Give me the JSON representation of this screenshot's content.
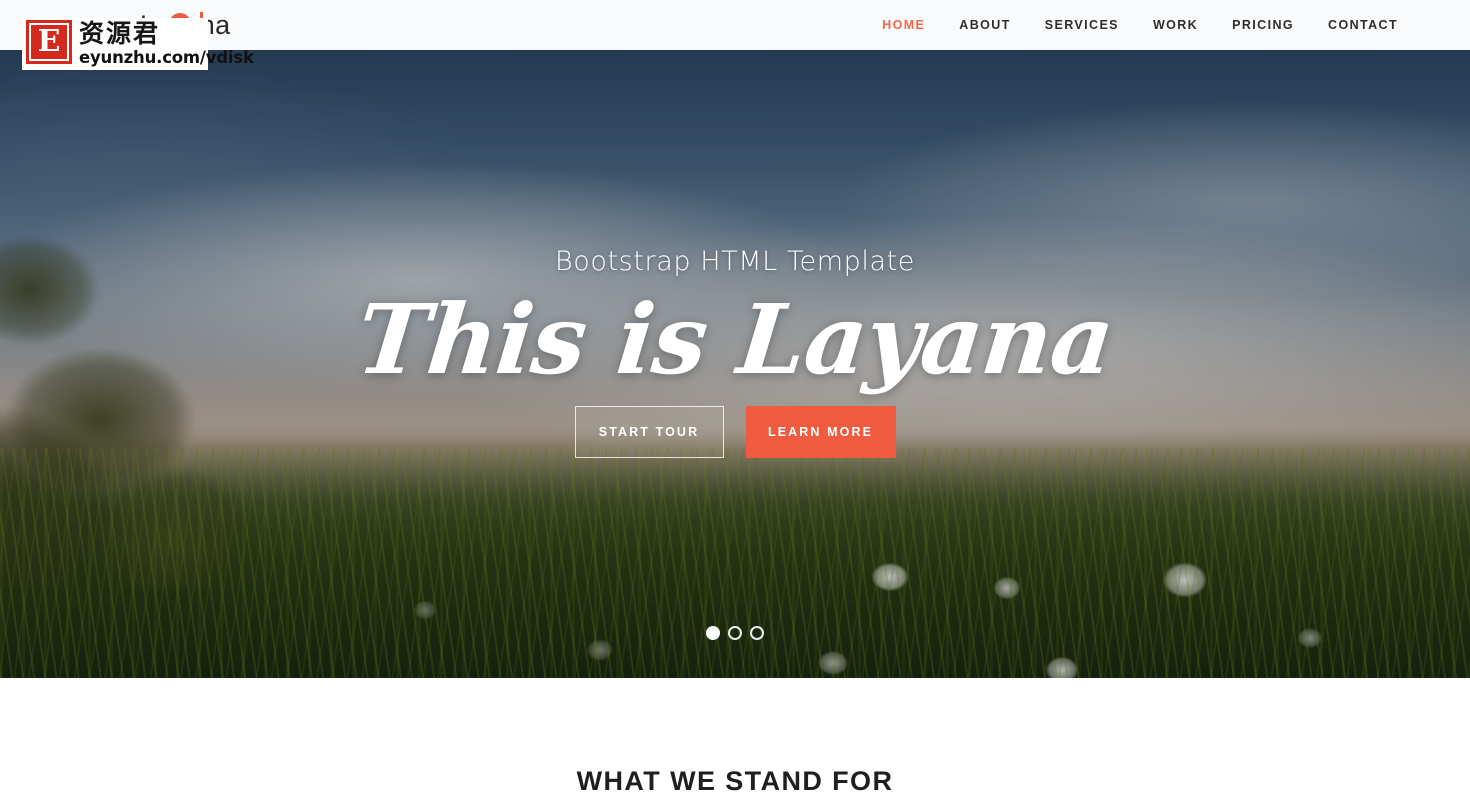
{
  "header": {
    "brand": "Layana",
    "brand_accent_color": "#ef5b3f",
    "background_color": "#f9fafb",
    "nav": [
      {
        "label": "HOME",
        "active": true
      },
      {
        "label": "ABOUT",
        "active": false
      },
      {
        "label": "SERVICES",
        "active": false
      },
      {
        "label": "WORK",
        "active": false
      },
      {
        "label": "PRICING",
        "active": false
      },
      {
        "label": "CONTACT",
        "active": false
      }
    ]
  },
  "hero": {
    "subtitle": "Bootstrap HTML Template",
    "title": "This is Layana",
    "buttons": {
      "primary_ghost": "START TOUR",
      "primary_solid": "LEARN MORE",
      "solid_color": "#ef5b3f"
    },
    "carousel": {
      "slide_count": 3,
      "active_index": 0
    },
    "image_description": "dandelion meadow at dusk with blue sky and clouds"
  },
  "section_stand": {
    "heading": "WHAT WE STAND FOR"
  },
  "watermark": {
    "badge_letter": "E",
    "badge_color": "#d6291e",
    "cn_text": "资源君",
    "url": "eyunzhu.com/vdisk"
  }
}
